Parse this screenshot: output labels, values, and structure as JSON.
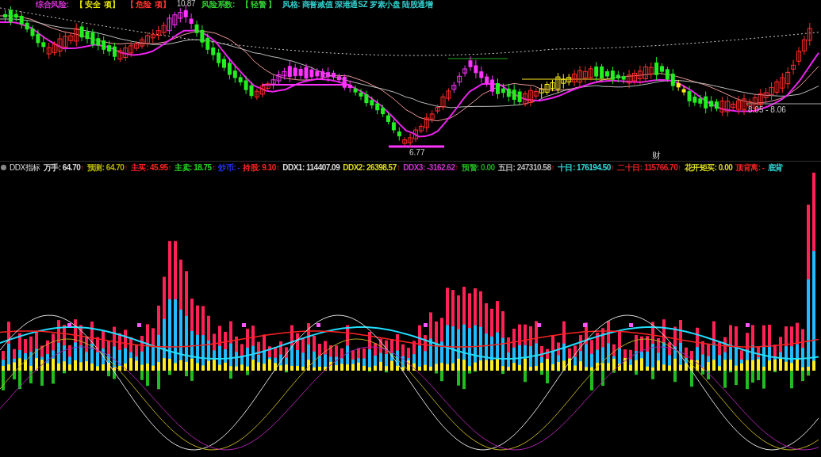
{
  "top_legend": [
    {
      "text": "综合风险:",
      "color": "#cc33cc"
    },
    {
      "text": "【 安全  项】",
      "color": "#e6e600"
    },
    {
      "text": "【 危险  项】",
      "color": "#ff3333"
    },
    {
      "text": "风险系数:",
      "color": "#33cc33"
    },
    {
      "text": "【 轻警 】",
      "color": "#33cc33"
    },
    {
      "text": "风格: 商誉减值 深港通SZ 罗素小盘 陆股通增",
      "color": "#33cccc"
    }
  ],
  "price_labels": {
    "high": "10.87",
    "low": "6.77",
    "range": "8.05 - 8.06",
    "marker": "财"
  },
  "indicator": {
    "name": "DDX指标",
    "items": [
      {
        "text": "万手: 64.70",
        "arrow": "↑",
        "color": "#dddddd"
      },
      {
        "text": "预测: 64.70",
        "arrow": "↑",
        "color": "#b3b300"
      },
      {
        "text": "主买: 45.95",
        "arrow": "↑",
        "color": "#ff2222"
      },
      {
        "text": "主卖: 18.75",
        "arrow": "↑",
        "color": "#22dd22"
      },
      {
        "text": "炒币: -",
        "color": "#2233ee"
      },
      {
        "text": "持股: 9.10",
        "arrow": "↑",
        "color": "#ff2222"
      },
      {
        "text": "DDX1: 114407.09",
        "color": "#dddddd"
      },
      {
        "text": "DDX2: 26398.57",
        "arrow": "↑",
        "color": "#dddd22"
      },
      {
        "text": "DDX3: -3162.62",
        "arrow": "↑",
        "color": "#cc33cc"
      },
      {
        "text": "预警: 0.00",
        "color": "#22aa22"
      },
      {
        "text": "五日: 247310.58",
        "arrow": "↑",
        "color": "#bbbbbb"
      },
      {
        "text": "十日: 176194.50",
        "arrow": "↑",
        "color": "#33dddd"
      },
      {
        "text": "二十日: 115766.70",
        "arrow": "↑",
        "color": "#ee2222"
      },
      {
        "text": "花开矩买: 0.00",
        "color": "#dddd22"
      },
      {
        "text": "顶背离: -",
        "color": "#ee2222"
      },
      {
        "text": "底背",
        "color": "#33dddd"
      }
    ]
  }
}
